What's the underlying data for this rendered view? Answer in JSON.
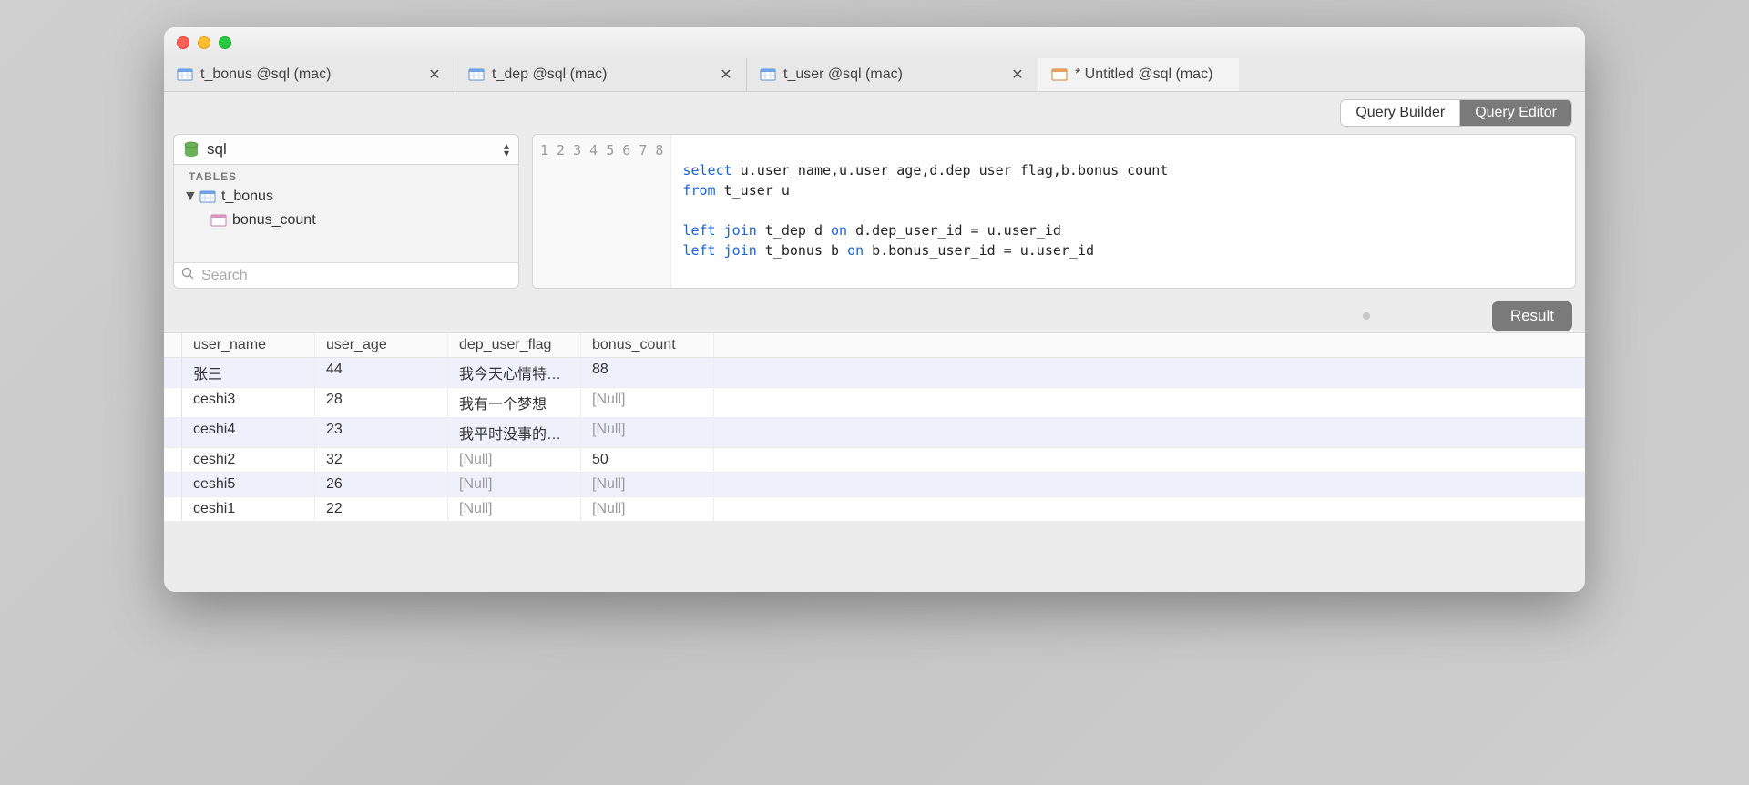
{
  "tabs": [
    {
      "label": "t_bonus @sql (mac)",
      "type": "table",
      "closable": true
    },
    {
      "label": "t_dep @sql (mac)",
      "type": "table",
      "closable": true
    },
    {
      "label": "t_user @sql (mac)",
      "type": "table",
      "closable": true
    },
    {
      "label": "* Untitled @sql (mac)",
      "type": "query",
      "closable": false,
      "active": true
    }
  ],
  "mode_buttons": {
    "builder": "Query Builder",
    "editor": "Query Editor"
  },
  "sidebar": {
    "db_name": "sql",
    "tables_header": "TABLES",
    "tree": [
      {
        "label": "t_bonus",
        "expanded": true,
        "children": [
          {
            "label": "bonus_count"
          }
        ]
      }
    ],
    "search_placeholder": "Search"
  },
  "editor": {
    "line_count": 8,
    "code_lines": [
      "",
      "<kw>select</kw> u.user_name,u.user_age,d.dep_user_flag,b.bonus_count",
      "<kw>from</kw> t_user u",
      "",
      "<kw>left</kw> <kw>join</kw> t_dep d <kw>on</kw> d.dep_user_id = u.user_id",
      "<kw>left</kw> <kw>join</kw> t_bonus b <kw>on</kw> b.bonus_user_id = u.user_id",
      "",
      ""
    ]
  },
  "result_button": "Result",
  "grid": {
    "columns": [
      "user_name",
      "user_age",
      "dep_user_flag",
      "bonus_count"
    ],
    "rows": [
      {
        "user_name": "张三",
        "user_age": "44",
        "dep_user_flag": "我今天心情特别好，",
        "bonus_count": "88"
      },
      {
        "user_name": "ceshi3",
        "user_age": "28",
        "dep_user_flag": "我有一个梦想",
        "bonus_count": null
      },
      {
        "user_name": "ceshi4",
        "user_age": "23",
        "dep_user_flag": "我平时没事的时候喜",
        "bonus_count": null
      },
      {
        "user_name": "ceshi2",
        "user_age": "32",
        "dep_user_flag": null,
        "bonus_count": "50"
      },
      {
        "user_name": "ceshi5",
        "user_age": "26",
        "dep_user_flag": null,
        "bonus_count": null
      },
      {
        "user_name": "ceshi1",
        "user_age": "22",
        "dep_user_flag": null,
        "bonus_count": null
      }
    ],
    "null_label": "[Null]"
  }
}
